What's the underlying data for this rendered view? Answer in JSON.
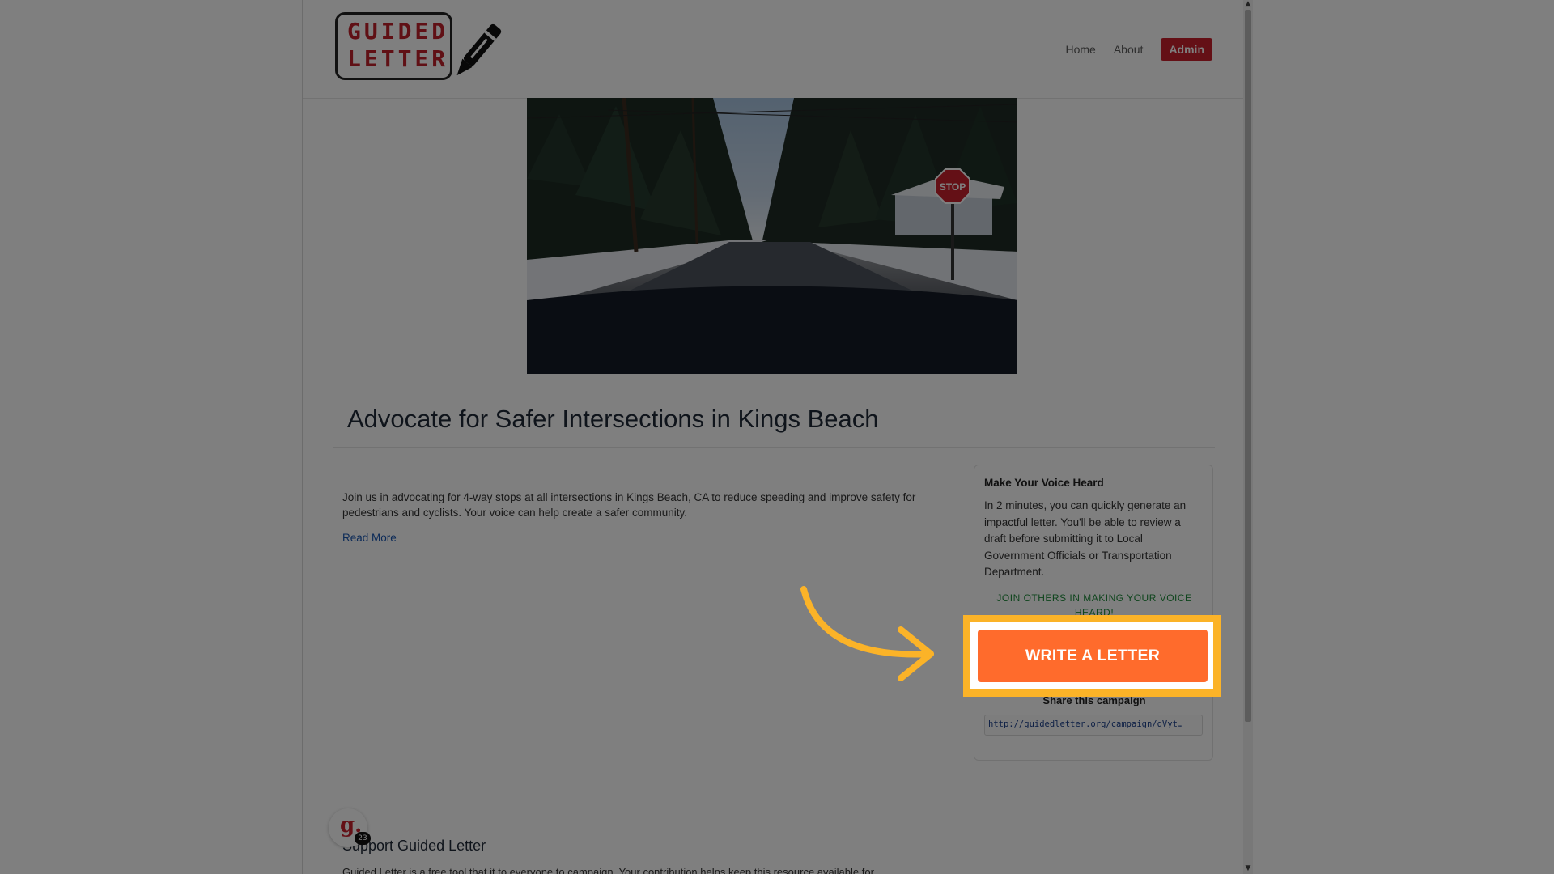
{
  "header": {
    "logo_line1": "GUIDED",
    "logo_line2": "LETTER",
    "nav": {
      "home": "Home",
      "about": "About",
      "admin": "Admin"
    }
  },
  "campaign": {
    "title": "Advocate for Safer Intersections in Kings Beach",
    "description": "Join us in advocating for 4-way stops at all intersections in Kings Beach, CA to reduce speeding and improve safety for pedestrians and cyclists. Your voice can help create a safer community.",
    "read_more": "Read More",
    "hero_sign": "STOP"
  },
  "sidebar": {
    "title": "Make Your Voice Heard",
    "text": "In 2 minutes, you can quickly generate an impactful letter. You'll be able to review a draft before submitting it to Local Government Officials or Transportation Department.",
    "join_text": "JOIN OTHERS IN MAKING YOUR VOICE HEARD!",
    "write_button": "WRITE A LETTER",
    "share_label": "Share this campaign",
    "share_url": "http://guidedletter.org/campaign/qVyt…"
  },
  "support": {
    "title": "Support Guided Letter",
    "text": "Guided Letter is a free tool that it to everyone to campaign. Your contribution helps keep this resource available for"
  },
  "widget": {
    "glyph": "g.",
    "badge": "23"
  },
  "colors": {
    "brand_red": "#c8202d",
    "cta_orange": "#ff6b2c",
    "highlight_yellow": "#fbb328",
    "link_blue": "#1a56b0",
    "join_green": "#1f8a3b"
  },
  "icons": {
    "pen": "pen-icon",
    "arrow": "arrow-icon"
  }
}
